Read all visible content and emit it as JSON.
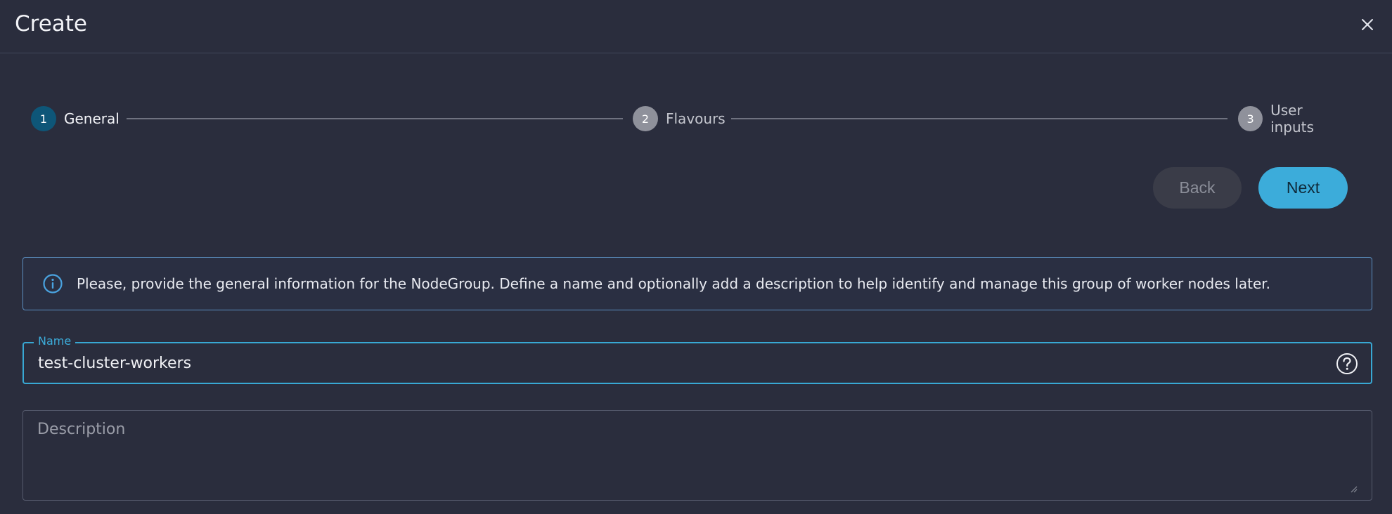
{
  "dialog": {
    "title": "Create"
  },
  "stepper": {
    "steps": [
      {
        "number": "1",
        "label": "General",
        "state": "active"
      },
      {
        "number": "2",
        "label": "Flavours",
        "state": "inactive"
      },
      {
        "number": "3",
        "label": "User inputs",
        "state": "inactive"
      }
    ]
  },
  "actions": {
    "back_label": "Back",
    "next_label": "Next"
  },
  "info": {
    "icon": "info-icon",
    "text": "Please, provide the general information for the NodeGroup. Define a name and optionally add a description to help identify and manage this group of worker nodes later."
  },
  "form": {
    "name": {
      "label": "Name",
      "value": "test-cluster-workers"
    },
    "description": {
      "placeholder": "Description",
      "value": ""
    }
  },
  "colors": {
    "background": "#2a2d3d",
    "accent": "#3cacda",
    "active_step": "#0e5678",
    "inactive_step": "#8f919b"
  }
}
